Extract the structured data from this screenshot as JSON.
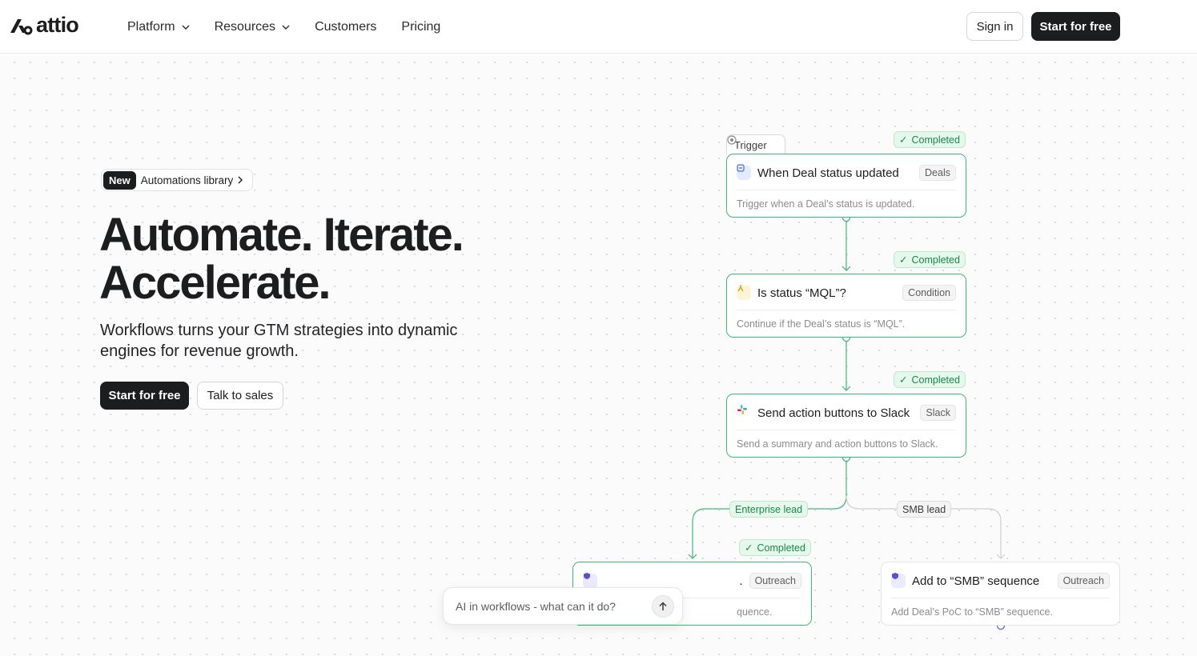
{
  "nav": {
    "logo": "attio",
    "links": [
      {
        "label": "Platform",
        "dropdown": true
      },
      {
        "label": "Resources",
        "dropdown": true
      },
      {
        "label": "Customers",
        "dropdown": false
      },
      {
        "label": "Pricing",
        "dropdown": false
      }
    ],
    "sign_in": "Sign in",
    "start": "Start for free"
  },
  "hero": {
    "pill_new": "New",
    "pill_text": "Automations library",
    "title_line1": "Automate. Iterate.",
    "title_line2": "Accelerate.",
    "subtitle": "Workflows turns your GTM strategies into dynamic engines for revenue growth.",
    "cta_primary": "Start for free",
    "cta_secondary": "Talk to sales"
  },
  "workflow": {
    "trigger_tab": "Trigger",
    "status_completed": "Completed",
    "nodes": [
      {
        "title": "When Deal status updated",
        "badge": "Deals",
        "desc": "Trigger when a Deal’s status is updated.",
        "icon": "deal-icon"
      },
      {
        "title": "Is status “MQL”?",
        "badge": "Condition",
        "desc": "Continue if the Deal’s status is “MQL”.",
        "icon": "condition-icon"
      },
      {
        "title": "Send action buttons to Slack",
        "badge": "Slack",
        "desc": "Send a summary and action buttons to Slack.",
        "icon": "slack-icon"
      },
      {
        "title": ".",
        "badge": "Outreach",
        "desc": "quence.",
        "icon": "outreach-icon"
      },
      {
        "title": "Add to “SMB” sequence",
        "badge": "Outreach",
        "desc": "Add Deal’s PoC to “SMB” sequence.",
        "icon": "outreach-icon"
      }
    ],
    "branch_left": "Enterprise lead",
    "branch_right": "SMB lead"
  },
  "ai": {
    "placeholder": "AI in workflows - what can it do?"
  },
  "colors": {
    "accent_green": "#3fb87a",
    "dark": "#1c1d1f"
  }
}
